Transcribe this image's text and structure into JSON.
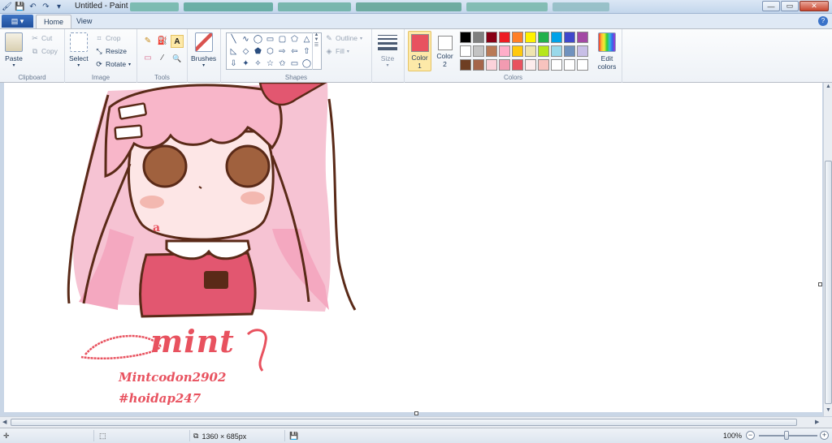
{
  "window": {
    "title": "Untitled - Paint",
    "qat_icons": [
      "paint-app-icon",
      "save-icon",
      "undo-icon",
      "redo-icon",
      "customize-qat-icon"
    ],
    "controls": {
      "minimize": "—",
      "maximize": "▭",
      "close": "✕"
    },
    "app_menu_glyph": "▤ ▾",
    "help_glyph": "?"
  },
  "tabs": [
    {
      "label": "Home",
      "active": true
    },
    {
      "label": "View",
      "active": false
    }
  ],
  "ribbon": {
    "clipboard": {
      "label": "Clipboard",
      "paste": "Paste",
      "cut": "Cut",
      "copy": "Copy"
    },
    "image": {
      "label": "Image",
      "select": "Select",
      "crop": "Crop",
      "resize": "Resize",
      "rotate": "Rotate"
    },
    "tools": {
      "label": "Tools",
      "glyphs": [
        "✎",
        "⛽",
        "A",
        "▭",
        "⁄",
        "🔍"
      ]
    },
    "brushes": {
      "label": "Brushes"
    },
    "shapes": {
      "label": "Shapes",
      "glyphs": [
        "╲",
        "∿",
        "◯",
        "▭",
        "▢",
        "⬠",
        "△",
        "◺",
        "◇",
        "⬟",
        "⬡",
        "⇨",
        "⇦",
        "⇧",
        "⇩",
        "✦",
        "✧",
        "☆",
        "✩",
        "▭",
        "◯"
      ],
      "outline": "Outline",
      "fill": "Fill"
    },
    "size": {
      "label": "Size"
    },
    "colors": {
      "label": "Colors",
      "color1": {
        "label": "Color 1",
        "value": "#e8525f"
      },
      "color2": {
        "label": "Color 2",
        "value": "#ffffff"
      },
      "edit": "Edit colors",
      "row1": [
        "#000000",
        "#7f7f7f",
        "#880015",
        "#ed1c24",
        "#ff7f27",
        "#fff200",
        "#22b14c",
        "#00a2e8",
        "#3f48cc",
        "#a349a4"
      ],
      "row2": [
        "#ffffff",
        "#c3c3c3",
        "#b97a57",
        "#ffaec9",
        "#ffc90e",
        "#efe4b0",
        "#b5e61d",
        "#99d9ea",
        "#7092be",
        "#c8bfe7"
      ],
      "row3": [
        "#6e3e22",
        "#a5654b",
        "#fbd2da",
        "#f29bb1",
        "#e8525f",
        "#fdecec",
        "#f7c3be",
        "#ffffff",
        "#ffffff",
        "#ffffff"
      ]
    }
  },
  "canvas": {
    "signature": "mint",
    "caption1": "Mintcodon2902",
    "caption2": "#hoidap247",
    "letter": "a"
  },
  "status": {
    "dimensions": "1360 × 685px",
    "zoom": "100%"
  }
}
